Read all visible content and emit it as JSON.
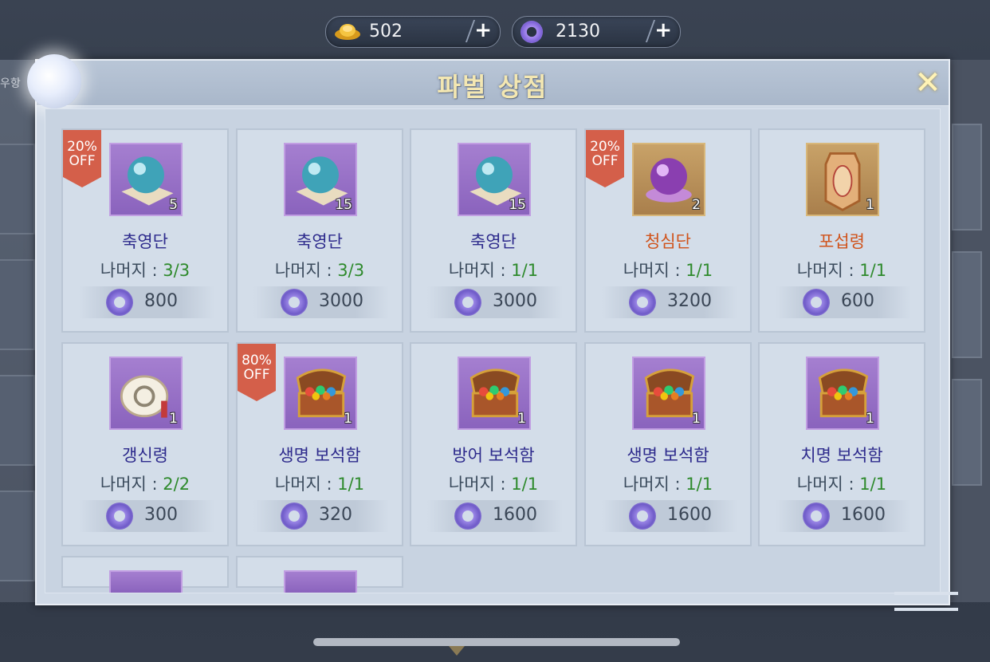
{
  "currencies": [
    {
      "icon": "gold-ingot-icon",
      "value": "502",
      "plus": "+"
    },
    {
      "icon": "jade-ring-icon",
      "value": "2130",
      "plus": "+"
    }
  ],
  "shop": {
    "title": "파벌 상점",
    "close": "✕",
    "side_tag": "우항",
    "remain_label": "나머지 : ",
    "items": [
      {
        "name": "축영단",
        "rare": false,
        "qty": "5",
        "remain": "3/3",
        "price": "800",
        "discount": "20%\nOFF",
        "icon": "blue-orb-icon",
        "frame": "purple"
      },
      {
        "name": "축영단",
        "rare": false,
        "qty": "15",
        "remain": "3/3",
        "price": "3000",
        "discount": "",
        "icon": "blue-orb-icon",
        "frame": "purple"
      },
      {
        "name": "축영단",
        "rare": false,
        "qty": "15",
        "remain": "1/1",
        "price": "3000",
        "discount": "",
        "icon": "blue-orb-icon",
        "frame": "purple"
      },
      {
        "name": "청심단",
        "rare": true,
        "qty": "2",
        "remain": "1/1",
        "price": "3200",
        "discount": "20%\nOFF",
        "icon": "purple-orb-icon",
        "frame": "gold"
      },
      {
        "name": "포섭령",
        "rare": true,
        "qty": "1",
        "remain": "1/1",
        "price": "600",
        "discount": "",
        "icon": "token-plaque-icon",
        "frame": "gold"
      },
      {
        "name": "갱신령",
        "rare": false,
        "qty": "1",
        "remain": "2/2",
        "price": "300",
        "discount": "",
        "icon": "refresh-token-icon",
        "frame": "purple"
      },
      {
        "name": "생명 보석함",
        "rare": false,
        "qty": "1",
        "remain": "1/1",
        "price": "320",
        "discount": "80%\nOFF",
        "icon": "treasure-chest-icon",
        "frame": "purple"
      },
      {
        "name": "방어 보석함",
        "rare": false,
        "qty": "1",
        "remain": "1/1",
        "price": "1600",
        "discount": "",
        "icon": "treasure-chest-icon",
        "frame": "purple"
      },
      {
        "name": "생명 보석함",
        "rare": false,
        "qty": "1",
        "remain": "1/1",
        "price": "1600",
        "discount": "",
        "icon": "treasure-chest-icon",
        "frame": "purple"
      },
      {
        "name": "치명 보석함",
        "rare": false,
        "qty": "1",
        "remain": "1/1",
        "price": "1600",
        "discount": "",
        "icon": "treasure-chest-icon",
        "frame": "purple"
      }
    ]
  },
  "colors": {
    "title": "#f3e7b2",
    "name_normal": "#2d2a8c",
    "name_rare": "#d0531b",
    "remain_number": "#2e8a2c",
    "discount_badge": "#d45f4a"
  }
}
